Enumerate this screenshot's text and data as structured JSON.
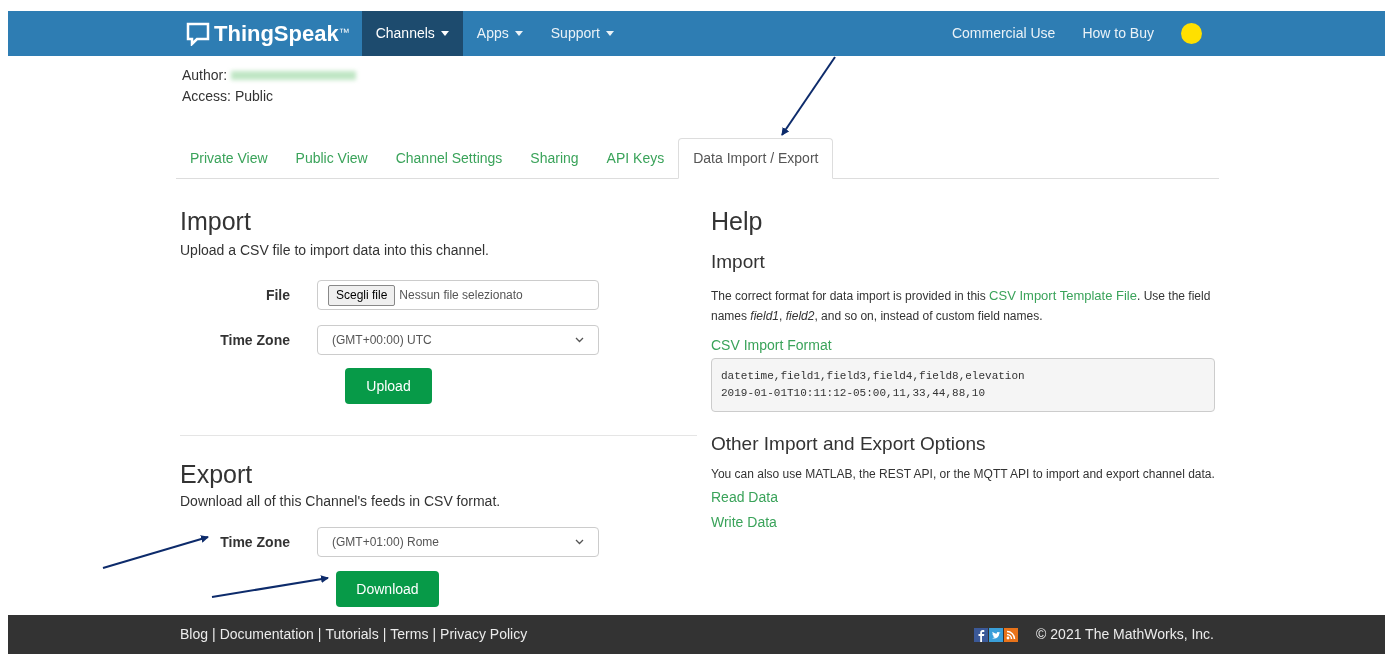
{
  "navbar": {
    "brand": "ThingSpeak",
    "trademark": "™",
    "menus": [
      {
        "label": "Channels",
        "selected": true,
        "caret": true
      },
      {
        "label": "Apps",
        "selected": false,
        "caret": true
      },
      {
        "label": "Support",
        "selected": false,
        "caret": true
      }
    ],
    "links": [
      "Commercial Use",
      "How to Buy"
    ]
  },
  "channel_info": [
    {
      "label": "Author:",
      "value_redacted": true
    },
    {
      "label": "Access: Public"
    }
  ],
  "tabs": [
    {
      "label": "Private View",
      "selected": false
    },
    {
      "label": "Public View",
      "selected": false
    },
    {
      "label": "Channel Settings",
      "selected": false
    },
    {
      "label": "Sharing",
      "selected": false
    },
    {
      "label": "API Keys",
      "selected": false
    },
    {
      "label": "Data Import / Export",
      "selected": true
    }
  ],
  "import": {
    "title": "Import",
    "description": "Upload a CSV file to import data into this channel.",
    "file_label": "File",
    "file_button": "Scegli file",
    "file_status": "Nessun file selezionato",
    "timezone_label": "Time Zone",
    "timezone": "(GMT+00:00) UTC",
    "button": "Upload"
  },
  "export": {
    "title": "Export",
    "description": "Download all of this Channel's feeds in CSV format.",
    "timezone_label": "Time Zone",
    "timezone": "(GMT+01:00) Rome",
    "button": "Download"
  },
  "help": {
    "title": "Help",
    "subtitle": "Import",
    "paragraph": [
      {
        "kind": "text",
        "text": "The correct format for data import is provided in this "
      },
      {
        "kind": "link",
        "text": "CSV Import Template File"
      },
      {
        "kind": "text",
        "text": ". Use the field names *field1*, *field2*, and so on, instead of custom field names."
      }
    ],
    "format_title": "CSV Import Format",
    "code": [
      "datetime,field1,field3,field4,field8,elevation",
      "2019-01-01T10:11:12-05:00,11,33,44,88,10"
    ],
    "options_title": "Other Import and Export Options",
    "options_text": "You can also use MATLAB, the REST API, or the MQTT API to import and export channel data.",
    "options_links": [
      "Read Data",
      "Write Data"
    ]
  },
  "footer": {
    "links": [
      "Blog",
      "Documentation",
      "Tutorials",
      "Terms",
      "Privacy Policy"
    ],
    "separator": "|",
    "copyright": "© 2021 The MathWorks, Inc."
  }
}
